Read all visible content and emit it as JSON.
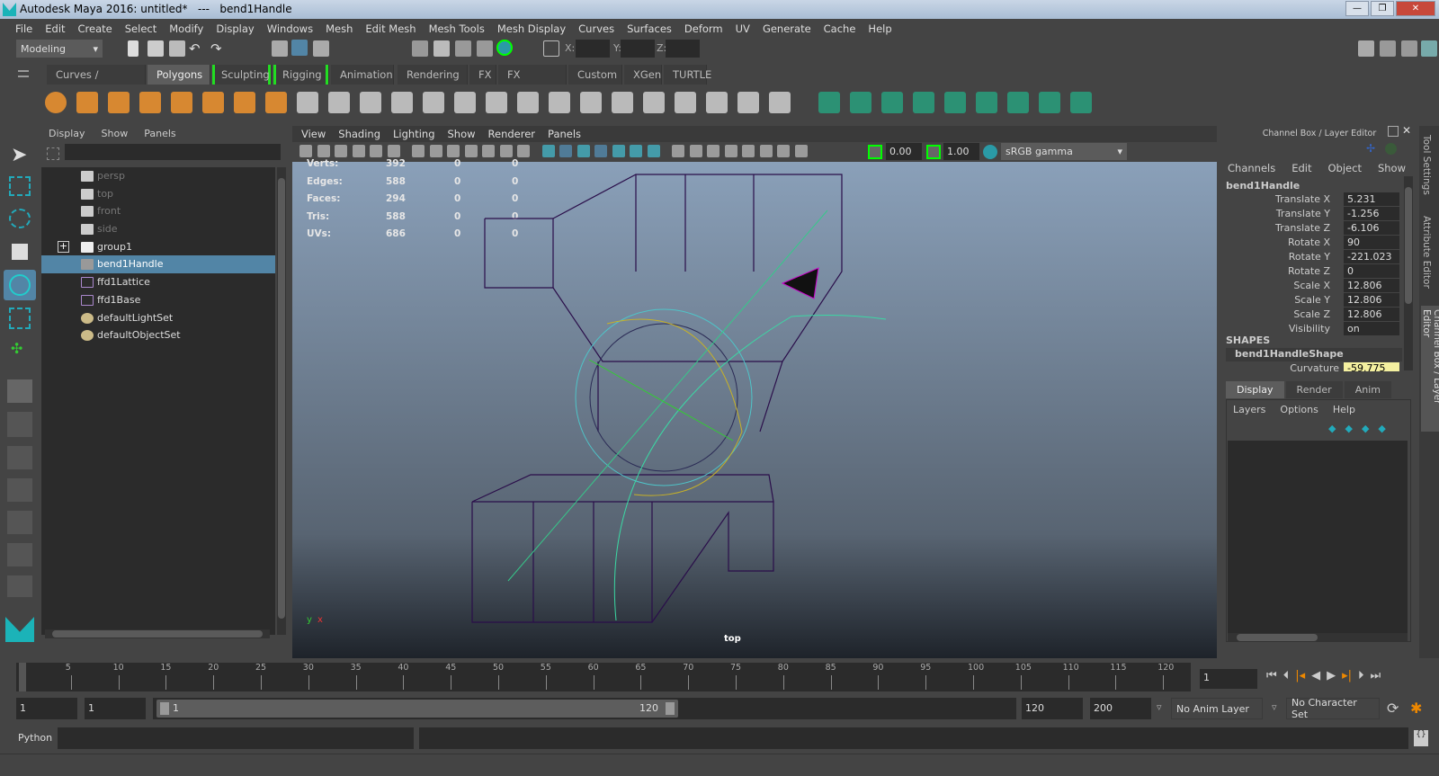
{
  "window": {
    "title": "Autodesk Maya 2016: untitled*   ---   bend1Handle"
  },
  "menubar": [
    "File",
    "Edit",
    "Create",
    "Select",
    "Modify",
    "Display",
    "Windows",
    "Mesh",
    "Edit Mesh",
    "Mesh Tools",
    "Mesh Display",
    "Curves",
    "Surfaces",
    "Deform",
    "UV",
    "Generate",
    "Cache",
    "Help"
  ],
  "statusline": {
    "mode": "Modeling",
    "x_label": "X:",
    "y_label": "Y:",
    "z_label": "Z:"
  },
  "shelf_tabs": [
    "Curves / Surfaces",
    "Polygons",
    "Sculpting",
    "Rigging",
    "Animation",
    "Rendering",
    "FX",
    "FX Caching",
    "Custom",
    "XGen",
    "TURTLE"
  ],
  "outliner": {
    "menu": [
      "Display",
      "Show",
      "Panels"
    ],
    "items": [
      {
        "label": "persp",
        "icon": "camera-icon",
        "dim": true
      },
      {
        "label": "top",
        "icon": "camera-icon",
        "dim": true
      },
      {
        "label": "front",
        "icon": "camera-icon",
        "dim": true
      },
      {
        "label": "side",
        "icon": "camera-icon",
        "dim": true
      },
      {
        "label": "group1",
        "icon": "group-icon"
      },
      {
        "label": "bend1Handle",
        "icon": "handle-icon",
        "selected": true
      },
      {
        "label": "ffd1Lattice",
        "icon": "lattice-icon"
      },
      {
        "label": "ffd1Base",
        "icon": "lattice-icon"
      },
      {
        "label": "defaultLightSet",
        "icon": "set-icon"
      },
      {
        "label": "defaultObjectSet",
        "icon": "set-icon"
      }
    ]
  },
  "viewport": {
    "menu": [
      "View",
      "Shading",
      "Lighting",
      "Show",
      "Renderer",
      "Panels"
    ],
    "exposure": "0.00",
    "gamma": "1.00",
    "color_space": "sRGB gamma",
    "camera_label": "top",
    "hud": [
      {
        "label": "Verts:",
        "v": [
          "392",
          "0",
          "0"
        ]
      },
      {
        "label": "Edges:",
        "v": [
          "588",
          "0",
          "0"
        ]
      },
      {
        "label": "Faces:",
        "v": [
          "294",
          "0",
          "0"
        ]
      },
      {
        "label": "Tris:",
        "v": [
          "588",
          "0",
          "0"
        ]
      },
      {
        "label": "UVs:",
        "v": [
          "686",
          "0",
          "0"
        ]
      }
    ]
  },
  "channel_box": {
    "title": "Channel Box / Layer Editor",
    "menu": [
      "Channels",
      "Edit",
      "Object",
      "Show"
    ],
    "object": "bend1Handle",
    "attrs": [
      [
        "Translate X",
        "5.231"
      ],
      [
        "Translate Y",
        "-1.256"
      ],
      [
        "Translate Z",
        "-6.106"
      ],
      [
        "Rotate X",
        "90"
      ],
      [
        "Rotate Y",
        "-221.023"
      ],
      [
        "Rotate Z",
        "0"
      ],
      [
        "Scale X",
        "12.806"
      ],
      [
        "Scale Y",
        "12.806"
      ],
      [
        "Scale Z",
        "12.806"
      ],
      [
        "Visibility",
        "on"
      ]
    ],
    "shapes_label": "SHAPES",
    "shape": "bend1HandleShape",
    "curvature_label": "Curvature",
    "curvature": "-59.775",
    "layer_tabs": [
      "Display",
      "Render",
      "Anim"
    ],
    "layer_menu": [
      "Layers",
      "Options",
      "Help"
    ]
  },
  "side_tabs": [
    "Tool Settings",
    "Attribute Editor",
    "Channel Box / Layer Editor"
  ],
  "timeline": {
    "ticks": [
      "5",
      "10",
      "15",
      "20",
      "25",
      "30",
      "35",
      "40",
      "45",
      "50",
      "55",
      "60",
      "65",
      "70",
      "75",
      "80",
      "85",
      "90",
      "95",
      "100",
      "105",
      "110",
      "115",
      "120"
    ],
    "current": "1",
    "current_field": "1"
  },
  "range": {
    "start": "1",
    "playback_start": "1",
    "slider_start": "1",
    "slider_end": "120",
    "playback_end": "120",
    "end": "200",
    "anim_layer": "No Anim Layer",
    "character_set": "No Character Set"
  },
  "command_line": {
    "language": "Python"
  }
}
